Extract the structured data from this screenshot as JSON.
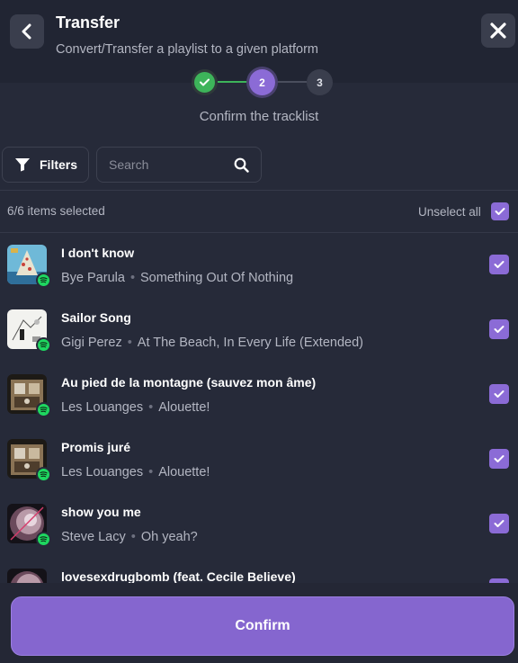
{
  "header": {
    "title": "Transfer",
    "subtitle": "Convert/Transfer a playlist to a given platform",
    "back_icon": "chevron-left-icon",
    "close_icon": "close-icon"
  },
  "stepper": {
    "steps": [
      {
        "label": "",
        "state": "done"
      },
      {
        "label": "2",
        "state": "active"
      },
      {
        "label": "3",
        "state": "upcoming"
      }
    ],
    "caption": "Confirm the tracklist"
  },
  "toolbar": {
    "filters_label": "Filters",
    "search_placeholder": "Search",
    "search_value": ""
  },
  "selection": {
    "count_text": "6/6 items selected",
    "unselect_label": "Unselect all",
    "all_checked": true
  },
  "tracks": [
    {
      "title": "I don't know",
      "artist": "Bye Parula",
      "album": "Something Out Of Nothing",
      "checked": true,
      "platform": "spotify"
    },
    {
      "title": "Sailor Song",
      "artist": "Gigi Perez",
      "album": "At The Beach, In Every Life (Extended)",
      "checked": true,
      "platform": "spotify"
    },
    {
      "title": "Au pied de la montagne (sauvez mon âme)",
      "artist": "Les Louanges",
      "album": "Alouette!",
      "checked": true,
      "platform": "spotify"
    },
    {
      "title": "Promis juré",
      "artist": "Les Louanges",
      "album": "Alouette!",
      "checked": true,
      "platform": "spotify"
    },
    {
      "title": "show you me",
      "artist": "Steve Lacy",
      "album": "Oh yeah?",
      "checked": true,
      "platform": "spotify"
    },
    {
      "title": "lovesexdrugbomb (feat. Cecile Believe)",
      "artist": "",
      "album": "",
      "checked": true,
      "platform": "spotify"
    }
  ],
  "footer": {
    "confirm_label": "Confirm"
  },
  "colors": {
    "background": "#262a39",
    "accent": "#8b6bd6",
    "success": "#3db45a",
    "spotify": "#1ed760"
  }
}
